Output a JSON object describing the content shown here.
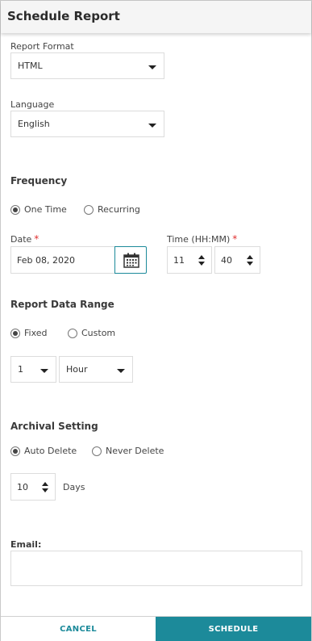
{
  "header": {
    "title": "Schedule Report"
  },
  "report_format": {
    "label": "Report Format",
    "value": "HTML"
  },
  "language": {
    "label": "Language",
    "value": "English"
  },
  "frequency": {
    "heading": "Frequency",
    "options": [
      "One Time",
      "Recurring"
    ],
    "selected": "One Time"
  },
  "date": {
    "label": "Date",
    "required_mark": "*",
    "value": "Feb 08, 2020",
    "icon": "calendar-icon"
  },
  "time": {
    "label": "Time (HH:MM)",
    "required_mark": "*",
    "hours": "11",
    "minutes": "40"
  },
  "data_range": {
    "heading": "Report Data Range",
    "options": [
      "Fixed",
      "Custom"
    ],
    "selected": "Fixed",
    "amount": "1",
    "unit": "Hour"
  },
  "archival": {
    "heading": "Archival Setting",
    "options": [
      "Auto Delete",
      "Never Delete"
    ],
    "selected": "Auto Delete",
    "days_value": "10",
    "days_label": "Days"
  },
  "email": {
    "label": "Email:",
    "value": ""
  },
  "footer": {
    "cancel_label": "CANCEL",
    "schedule_label": "SCHEDULE"
  },
  "colors": {
    "accent": "#1c8a9a",
    "required": "#e02f2f",
    "header_bg": "#f5f5f5"
  }
}
